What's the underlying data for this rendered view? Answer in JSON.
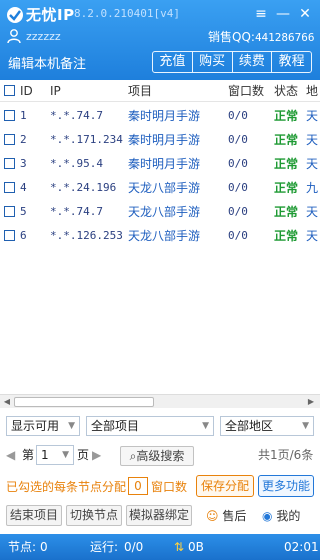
{
  "header": {
    "app_name": "无忧IP",
    "version": "8.2.0.210401[v4]",
    "username": "zzzzzz",
    "sales_label": "销售QQ:",
    "sales_qq": "441286766",
    "edit_note": "编辑本机备注",
    "nav": [
      {
        "label": "充值"
      },
      {
        "label": "购买"
      },
      {
        "label": "续费"
      },
      {
        "label": "教程"
      }
    ],
    "icons": {
      "logo": "logo-icon",
      "menu": "menu-icon",
      "minimize": "minimize-icon",
      "close": "close-icon",
      "user": "user-icon"
    }
  },
  "table": {
    "columns": [
      "ID",
      "IP",
      "项目",
      "窗口数",
      "状态",
      "地"
    ],
    "rows": [
      {
        "id": "1",
        "ip": "*.*.74.7",
        "project": "秦时明月手游",
        "windows": "0/0",
        "status": "正常",
        "region": "天"
      },
      {
        "id": "2",
        "ip": "*.*.171.234",
        "project": "秦时明月手游",
        "windows": "0/0",
        "status": "正常",
        "region": "天"
      },
      {
        "id": "3",
        "ip": "*.*.95.4",
        "project": "秦时明月手游",
        "windows": "0/0",
        "status": "正常",
        "region": "天"
      },
      {
        "id": "4",
        "ip": "*.*.24.196",
        "project": "天龙八部手游",
        "windows": "0/0",
        "status": "正常",
        "region": "九"
      },
      {
        "id": "5",
        "ip": "*.*.74.7",
        "project": "天龙八部手游",
        "windows": "0/0",
        "status": "正常",
        "region": "天"
      },
      {
        "id": "6",
        "ip": "*.*.126.253",
        "project": "天龙八部手游",
        "windows": "0/0",
        "status": "正常",
        "region": "天"
      }
    ]
  },
  "filters": {
    "display": "显示可用",
    "project": "全部项目",
    "region": "全部地区"
  },
  "pager": {
    "prev": "第",
    "page": "1",
    "suffix": "页",
    "advanced_search": "高级搜索",
    "info": "共1页/6条"
  },
  "allocation": {
    "label": "已勾选的每条节点分配",
    "value": "0",
    "unit": "窗口数",
    "save": "保存分配",
    "more": "更多功能"
  },
  "actions": {
    "end_project": "结束项目",
    "switch_node": "切换节点",
    "emulator_bind": "模拟器绑定",
    "after_sales": "售后",
    "mine": "我的"
  },
  "statusbar": {
    "nodes_label": "节点:",
    "nodes": "0",
    "running_label": "运行:",
    "running": "0/0",
    "traffic": "0B",
    "time": "02:01"
  },
  "colors": {
    "header_blue": "#1e7fdc",
    "status_ok": "#1e9a33",
    "accent_orange": "#e8820c",
    "link_blue": "#1f5fbf"
  }
}
